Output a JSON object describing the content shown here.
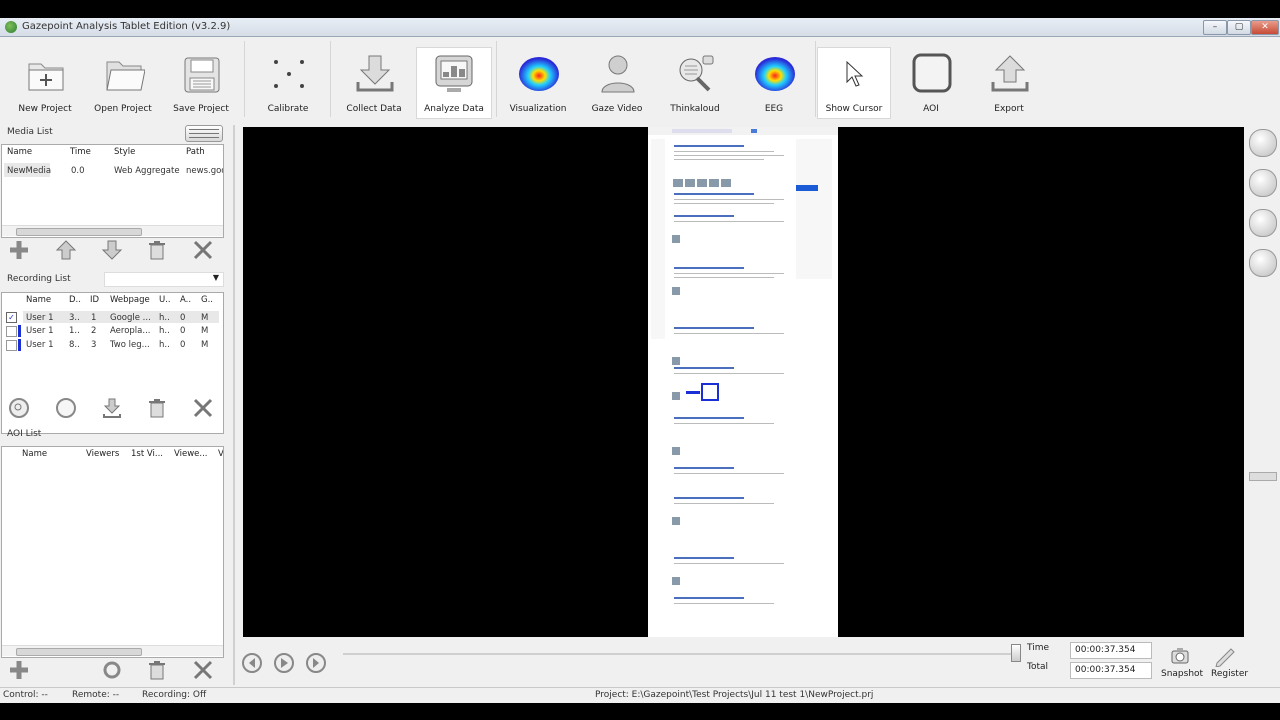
{
  "window": {
    "title": "Gazepoint Analysis Tablet Edition (v3.2.9)",
    "min": "–",
    "max": "▢",
    "close": "✕"
  },
  "toolbar": {
    "new_project": "New Project",
    "open_project": "Open Project",
    "save_project": "Save Project",
    "calibrate": "Calibrate",
    "collect_data": "Collect Data",
    "analyze_data": "Analyze Data",
    "visualization": "Visualization",
    "gaze_video": "Gaze Video",
    "thinkaloud": "Thinkaloud",
    "eeg": "EEG",
    "show_cursor": "Show Cursor",
    "aoi": "AOI",
    "export": "Export"
  },
  "media_list": {
    "title": "Media List",
    "columns": [
      "Name",
      "Time",
      "Style",
      "Path"
    ],
    "rows": [
      {
        "name": "NewMedia",
        "time": "0.0",
        "style": "Web Aggregate",
        "path": "news.goo"
      }
    ]
  },
  "recording_list": {
    "title": "Recording List",
    "columns": [
      "Name",
      "D..",
      "ID",
      "Webpage",
      "U..",
      "A..",
      "G.."
    ],
    "rows": [
      {
        "checked": true,
        "color": "#ffffff",
        "name": "User 1",
        "d": "3..",
        "id": "1",
        "webpage": "Google ...",
        "u": "h..",
        "a": "0",
        "g": "M"
      },
      {
        "checked": false,
        "color": "#1b2fd6",
        "name": "User 1",
        "d": "1..",
        "id": "2",
        "webpage": "Aeropla...",
        "u": "h..",
        "a": "0",
        "g": "M"
      },
      {
        "checked": false,
        "color": "#1b2fd6",
        "name": "User 1",
        "d": "8..",
        "id": "3",
        "webpage": "Two leg...",
        "u": "h..",
        "a": "0",
        "g": "M"
      }
    ]
  },
  "aoi_list": {
    "title": "AOI List",
    "columns": [
      "Name",
      "Viewers",
      "1st Vi...",
      "Viewe...",
      "V"
    ]
  },
  "playback": {
    "time_label": "Time",
    "total_label": "Total",
    "time_value": "00:00:37.354",
    "total_value": "00:00:37.354",
    "snapshot": "Snapshot",
    "register": "Register"
  },
  "status": {
    "control": "Control: --",
    "remote": "Remote: --",
    "recording": "Recording: Off",
    "project": "Project: E:\\Gazepoint\\Test Projects\\Jul 11 test 1\\NewProject.prj"
  },
  "colors": {
    "accent_blue": "#1b2fd6",
    "heatmap_center": "#ff3030",
    "heatmap_outer": "#2a2ad8"
  }
}
